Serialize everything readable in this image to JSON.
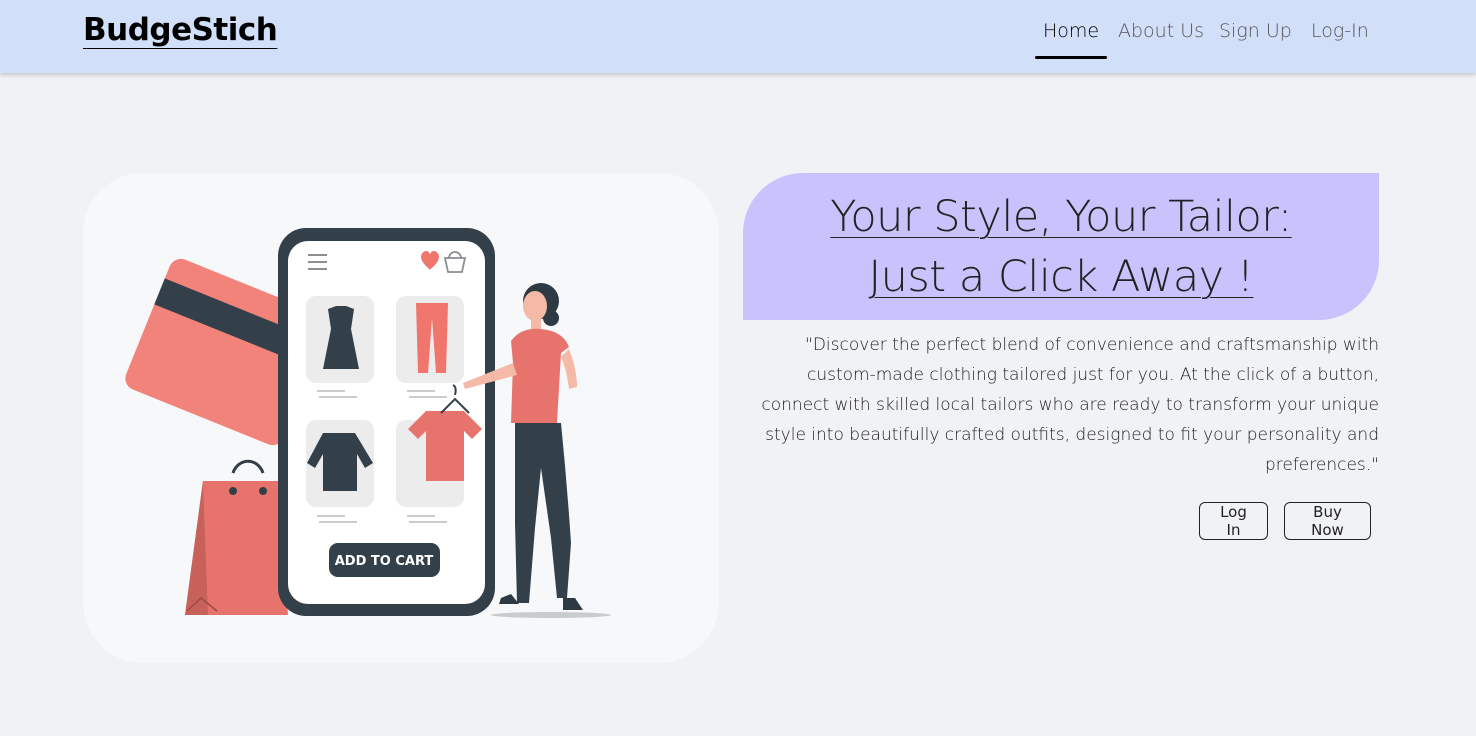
{
  "brand": "BudgeStich",
  "nav": {
    "items": [
      {
        "label": "Home",
        "active": true
      },
      {
        "label": "About Us"
      },
      {
        "label": "Sign Up"
      },
      {
        "label": "Log-In"
      }
    ]
  },
  "hero": {
    "illustration": {
      "button_label": "ADD TO CART",
      "icons": [
        "menu-icon",
        "heart-icon",
        "basket-icon"
      ]
    },
    "headline_line1": "Your Style, Your Tailor:",
    "headline_line2": "Just a Click Away !",
    "description": "\"Discover the perfect blend of convenience and craftsmanship with custom-made clothing tailored just for you. At the click of a button, connect with skilled local tailors who are ready to transform your unique style into beautifully crafted outfits, designed to fit your personality and preferences.\"",
    "login_button": "Log In",
    "buy_button": "Buy Now"
  },
  "colors": {
    "navbar": "#d2dff9",
    "headline_bg": "#c8c3fc",
    "accent": "#ef7b73",
    "dark": "#344049"
  }
}
